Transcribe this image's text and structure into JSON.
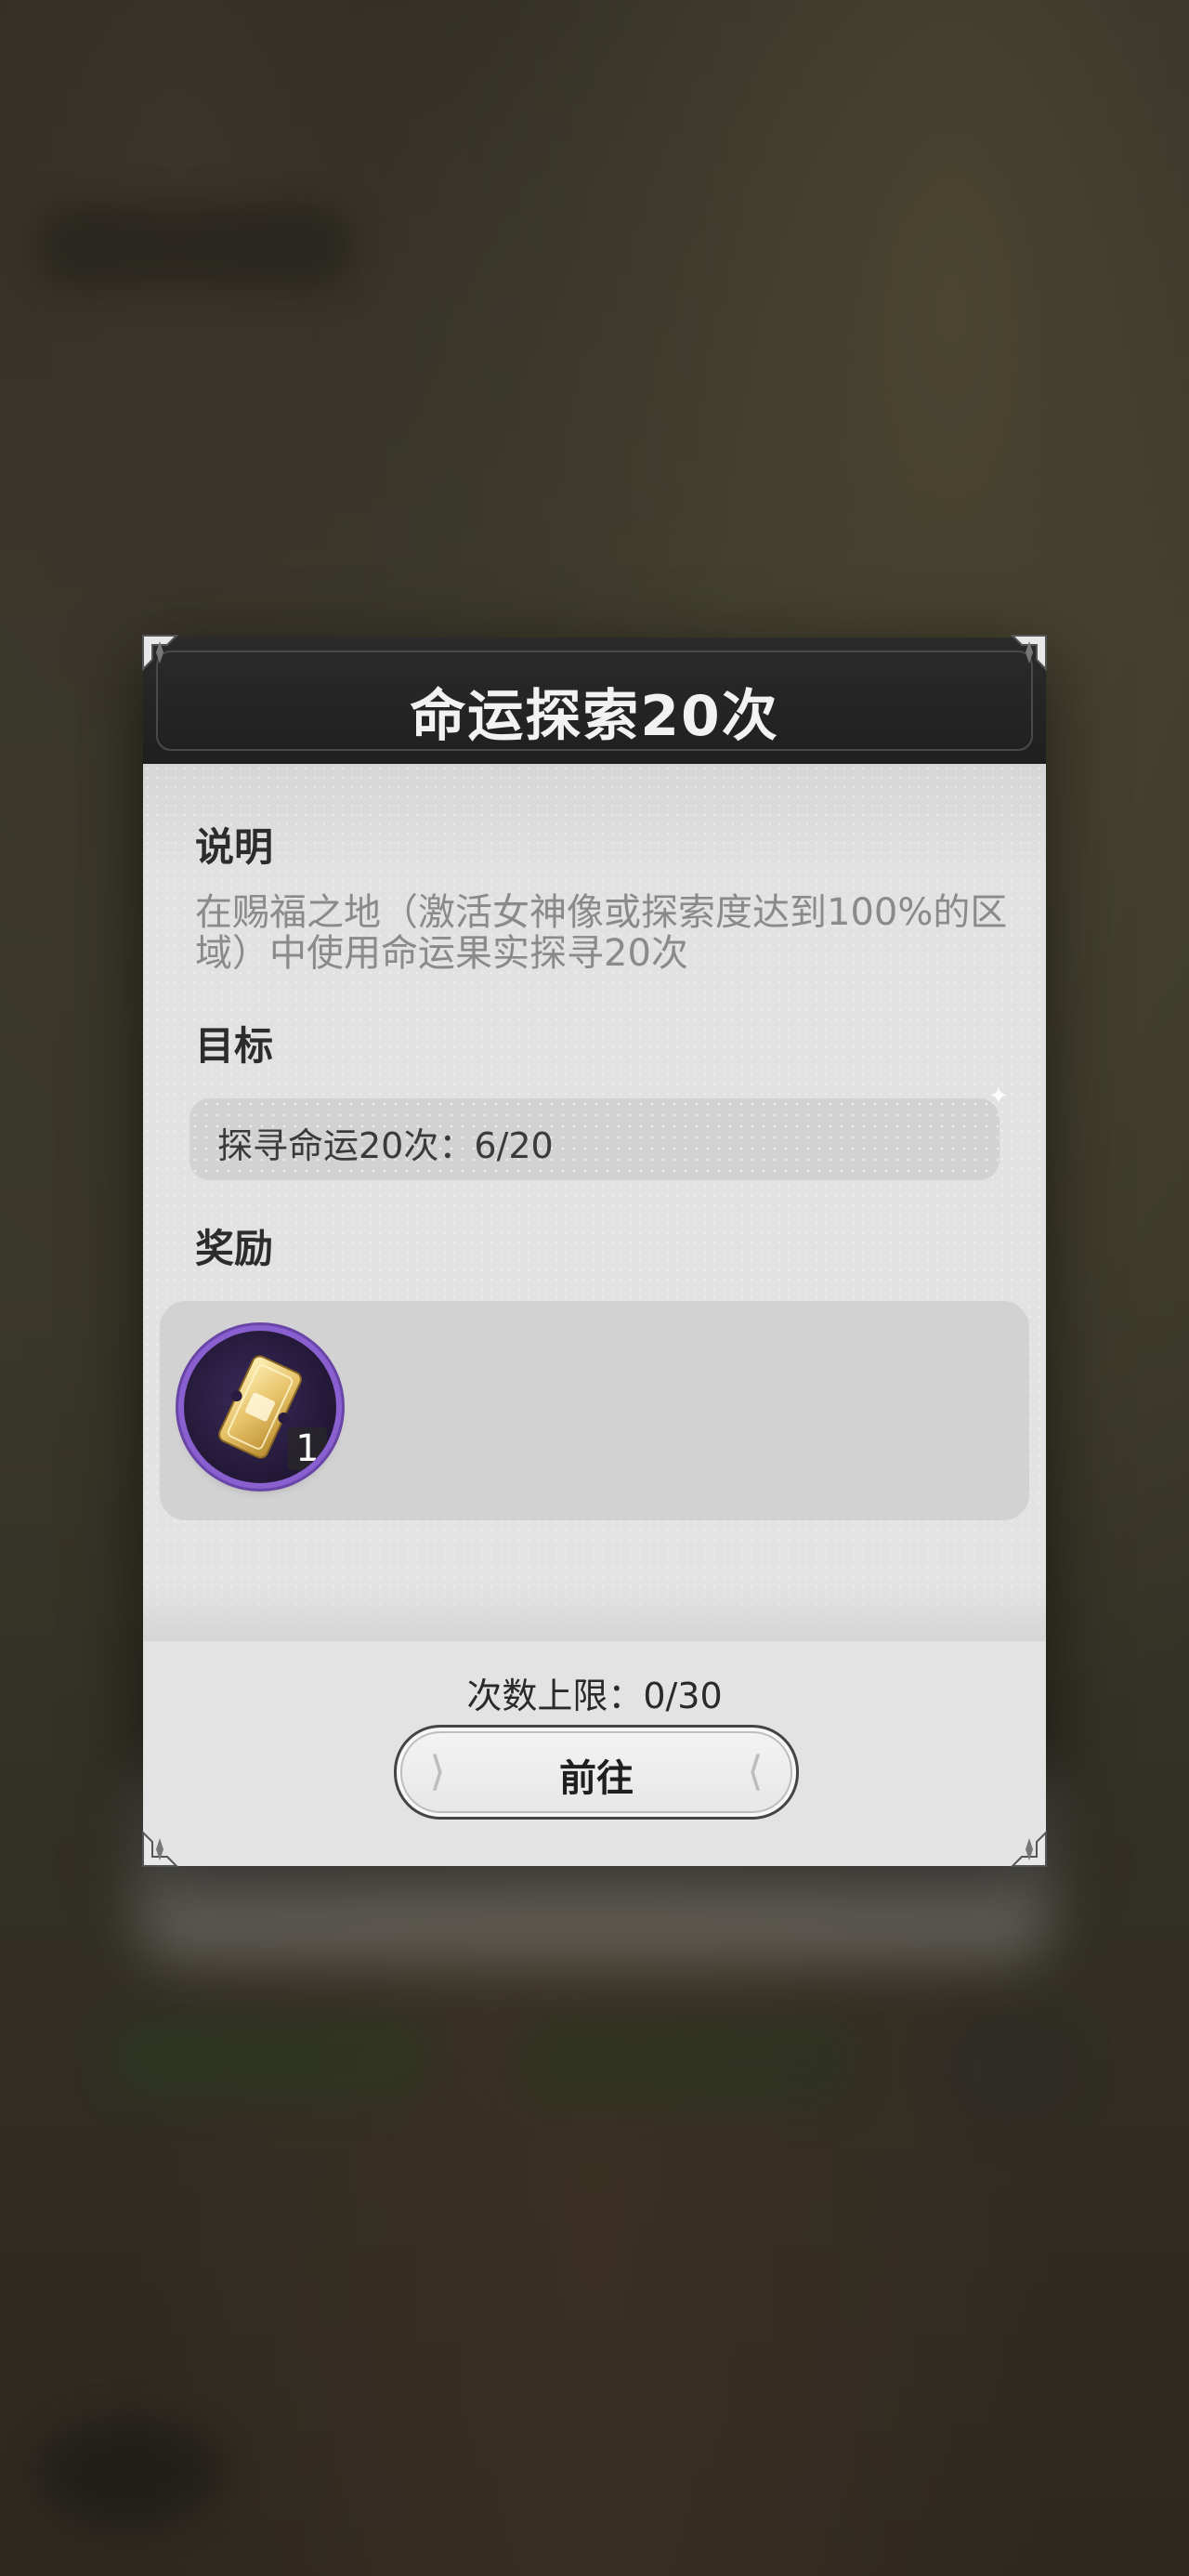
{
  "dialog": {
    "title": "命运探索20次",
    "description": {
      "heading": "说明",
      "text": "在赐福之地（激活女神像或探索度达到100%的区域）中使用命运果实探寻20次"
    },
    "target": {
      "heading": "目标",
      "text": "探寻命运20次：6/20"
    },
    "reward": {
      "heading": "奖励",
      "items": [
        {
          "icon": "golden-ticket-icon",
          "count": "1"
        }
      ]
    },
    "limit_text": "次数上限：0/30",
    "go_button_label": "前往"
  },
  "colors": {
    "header_bg": "#222222",
    "body_bg": "#e3e3e3",
    "reward_ring": "#8a5fd0",
    "title_text": "#f2f2f2",
    "desc_text": "#8a8a8a"
  }
}
